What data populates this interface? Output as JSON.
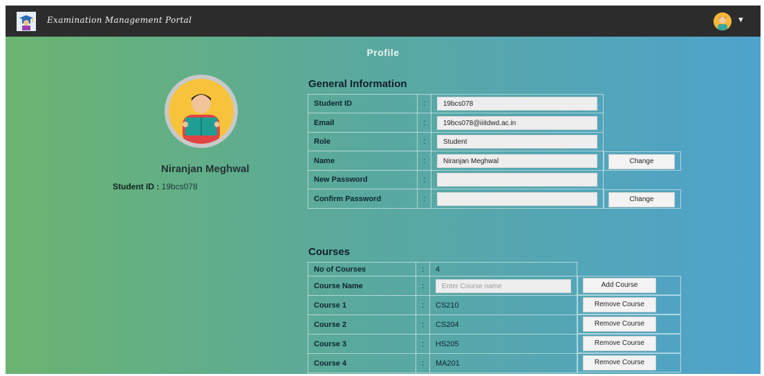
{
  "app": {
    "title": "Examination Management Portal"
  },
  "page": {
    "title": "Profile"
  },
  "profile": {
    "name": "Niranjan Meghwal",
    "id_label": "Student ID",
    "id_value": "19bcs078"
  },
  "general": {
    "heading": "General Information",
    "rows": [
      {
        "label": "Student ID",
        "value": "19bcs078"
      },
      {
        "label": "Email",
        "value": "19bcs078@iiitdwd.ac.in"
      },
      {
        "label": "Role",
        "value": "Student"
      },
      {
        "label": "Name",
        "value": "Niranjan Meghwal"
      },
      {
        "label": "New Password",
        "value": ""
      },
      {
        "label": "Confirm Password",
        "value": ""
      }
    ],
    "colon": ":",
    "change_label": "Change"
  },
  "courses": {
    "heading": "Courses",
    "count_label": "No of Courses",
    "count_value": "4",
    "name_label": "Course Name",
    "name_placeholder": "Enter Course name",
    "add_label": "Add Course",
    "remove_label": "Remove Course",
    "items": [
      {
        "label": "Course 1",
        "value": "CS210"
      },
      {
        "label": "Course 2",
        "value": "CS204"
      },
      {
        "label": "Course 3",
        "value": "HS205"
      },
      {
        "label": "Course 4",
        "value": "MA201"
      }
    ]
  },
  "colors": {
    "navbar": "#2c2c2c",
    "gradient_start": "#6bb470",
    "gradient_end": "#4ea3cc",
    "avatar": "#f7c33b"
  }
}
